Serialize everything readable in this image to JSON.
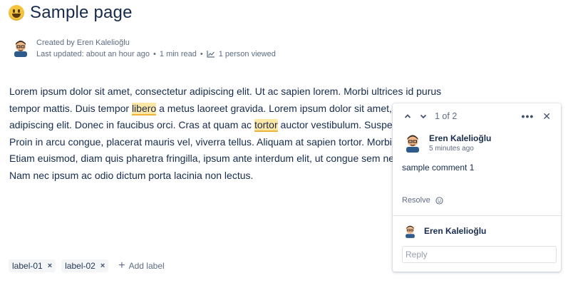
{
  "page": {
    "title": "Sample page",
    "icon": "grinning-face-emoji"
  },
  "byline": {
    "created_by": "Created by Eren Kalelioğlu",
    "last_updated": "Last updated: about an hour ago",
    "read_time": "1 min read",
    "viewed": "1 person viewed",
    "separator": "•"
  },
  "body": {
    "line1": "Lorem ipsum dolor sit amet, consectetur adipiscing elit. Ut ac sapien lorem. Morbi ultrices id purus",
    "line2_pre": "tempor mattis. Duis tempor ",
    "line2_hl": "libero",
    "line2_post": " a metus laoreet gravida. Lorem ipsum dolor sit amet,",
    "line3_pre": "adipiscing elit. Donec in faucibus orci. Cras at quam ac ",
    "line3_hl": "tortor",
    "line3_post": " auctor vestibulum. Suspe",
    "line4": "Proin in arcu congue, placerat mauris vel, viverra tellus. Aliquam at sapien tortor. Morbi",
    "line5": "Etiam euismod, diam quis pharetra fringilla, ipsum ante interdum elit, ut congue sem ne",
    "line6": "Nam nec ipsum ac odio dictum porta lacinia non lectus."
  },
  "labels": {
    "items": [
      "label-01",
      "label-02"
    ],
    "remove_glyph": "×",
    "add_label": "Add label",
    "add_glyph": "+"
  },
  "comment": {
    "prev_glyph": "⌃",
    "next_glyph": "⌄",
    "count": "1 of 2",
    "more_glyph": "•••",
    "close_glyph": "✕",
    "author": "Eren Kalelioğlu",
    "time": "5 minutes ago",
    "text": "sample comment 1",
    "resolve": "Resolve",
    "reply_author": "Eren Kalelioğlu",
    "reply_placeholder": "Reply"
  },
  "colors": {
    "text": "#172b4d",
    "subtle": "#5e6c84",
    "highlight": "#ffe7a6",
    "highlight_border": "#f0b23b"
  }
}
